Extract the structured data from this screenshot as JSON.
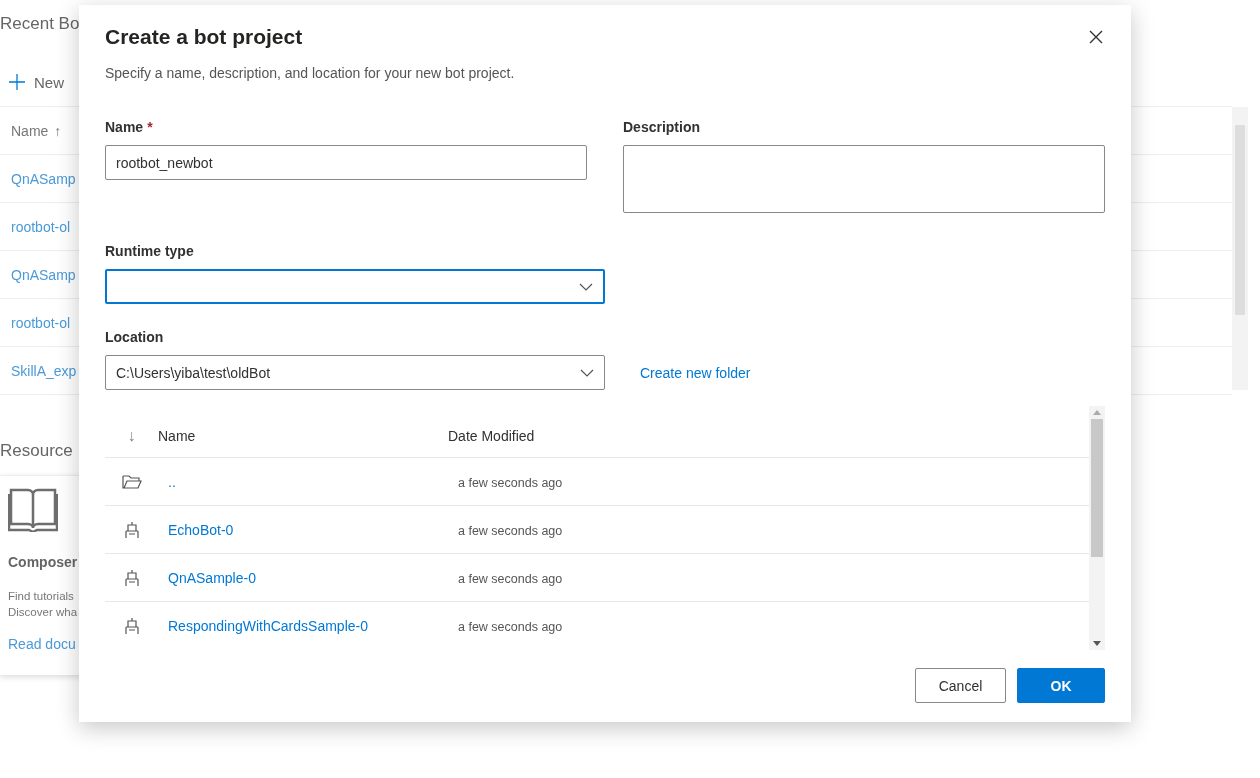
{
  "background": {
    "section_title": "Recent Bo",
    "new_button": "New",
    "table": {
      "column": "Name",
      "sort_glyph": "↑",
      "rows": [
        "QnASamp",
        "rootbot-ol",
        "QnASamp",
        "rootbot-ol",
        "SkillA_exp"
      ]
    },
    "resources_title": "Resource",
    "card": {
      "title": "Composer",
      "lines": [
        "Find tutorials",
        "Discover wha"
      ],
      "link": "Read docu"
    }
  },
  "dialog": {
    "title": "Create a bot project",
    "subtitle": "Specify a name, description, and location for your new bot project.",
    "name_field": {
      "label": "Name",
      "required_mark": "*",
      "value": "rootbot_newbot"
    },
    "description_field": {
      "label": "Description"
    },
    "runtime_field": {
      "label": "Runtime type",
      "focused": true
    },
    "location_field": {
      "label": "Location",
      "value": "C:\\Users\\yiba\\test\\oldBot",
      "focused": false
    },
    "create_folder_link": "Create new folder",
    "file_list": {
      "sort_glyph": "↓",
      "columns": [
        "Name",
        "Date Modified"
      ],
      "rows": [
        {
          "kind": "folder",
          "name": "..",
          "modified": "a few seconds ago"
        },
        {
          "kind": "bot",
          "name": "EchoBot-0",
          "modified": "a few seconds ago"
        },
        {
          "kind": "bot",
          "name": "QnASample-0",
          "modified": "a few seconds ago"
        },
        {
          "kind": "bot",
          "name": "RespondingWithCardsSample-0",
          "modified": "a few seconds ago"
        }
      ]
    },
    "buttons": [
      {
        "label": "Cancel",
        "kind": "default"
      },
      {
        "label": "OK",
        "kind": "primary"
      }
    ]
  }
}
